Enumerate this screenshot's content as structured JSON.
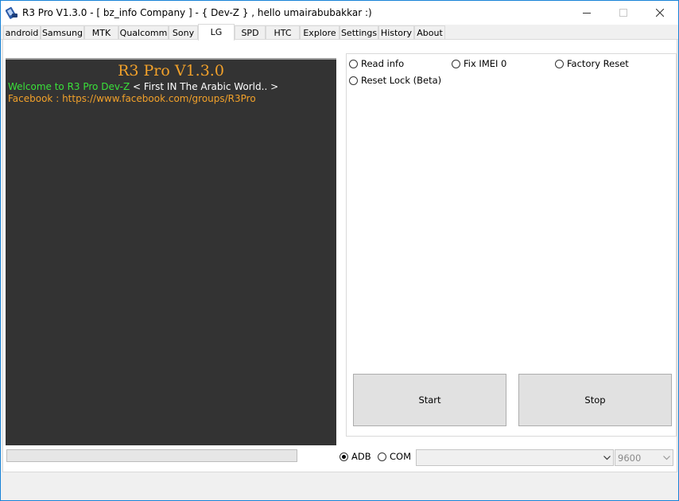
{
  "window": {
    "title": "R3 Pro V1.3.0 - [ bz_info Company ] -  { Dev-Z } , hello umairabubakkar :)",
    "icon": "app-icon"
  },
  "tabs": [
    {
      "label": "android",
      "active": false
    },
    {
      "label": "Samsung",
      "active": false
    },
    {
      "label": "MTK",
      "active": false
    },
    {
      "label": "Qualcomm",
      "active": false
    },
    {
      "label": "Sony",
      "active": false
    },
    {
      "label": "LG",
      "active": true
    },
    {
      "label": "SPD",
      "active": false
    },
    {
      "label": "HTC",
      "active": false
    },
    {
      "label": "Explore",
      "active": false
    },
    {
      "label": "Settings",
      "active": false
    },
    {
      "label": "History",
      "active": false
    },
    {
      "label": "About",
      "active": false
    }
  ],
  "console": {
    "title": "R3 Pro V1.3.0",
    "welcome": "Welcome to R3 Pro Dev-Z",
    "tagline": " < First IN The Arabic World.. >",
    "facebook_label": "Facebook : ",
    "facebook_url": "https://www.facebook.com/groups/R3Pro"
  },
  "options": [
    {
      "label": "Read info",
      "checked": false
    },
    {
      "label": "Fix IMEI 0",
      "checked": false
    },
    {
      "label": "Factory Reset",
      "checked": false
    },
    {
      "label": "Reset Lock (Beta)",
      "checked": false
    }
  ],
  "buttons": {
    "start": "Start",
    "stop": "Stop"
  },
  "progress": {
    "value": 0
  },
  "connection": {
    "adb_label": "ADB",
    "adb_checked": true,
    "com_label": "COM",
    "com_checked": false,
    "port_value": "",
    "baud_value": "9600"
  },
  "colors": {
    "console_bg": "#333333",
    "console_title": "#f2a12a",
    "welcome": "#3ae13a",
    "tagline": "#ffffff",
    "facebook": "#f2a12a"
  }
}
